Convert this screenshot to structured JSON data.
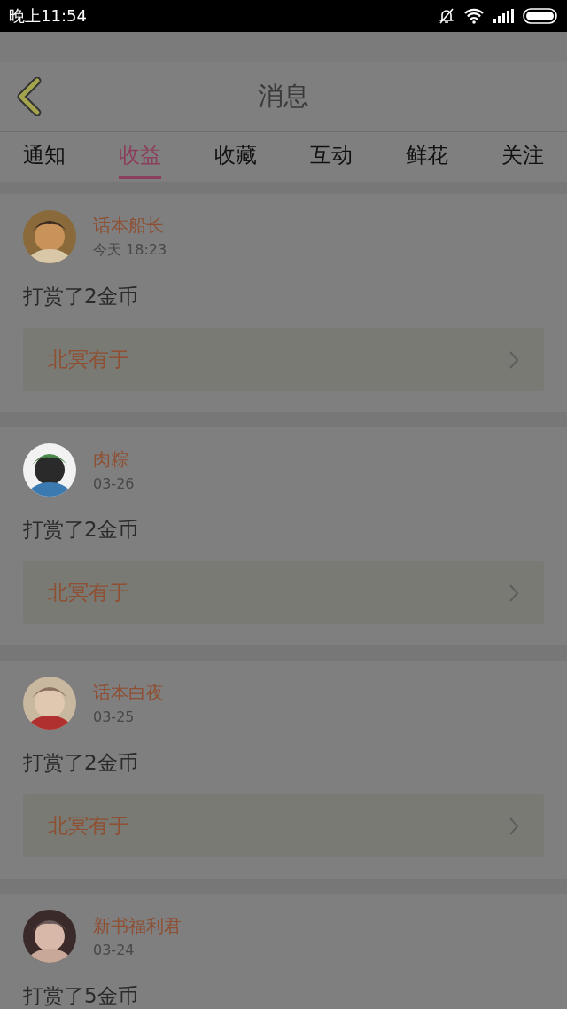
{
  "status_bar": {
    "time": "晚上11:54"
  },
  "header": {
    "title": "消息"
  },
  "tabs": [
    {
      "label": "通知",
      "selected": false
    },
    {
      "label": "收益",
      "selected": true
    },
    {
      "label": "收藏",
      "selected": false
    },
    {
      "label": "互动",
      "selected": false
    },
    {
      "label": "鲜花",
      "selected": false
    },
    {
      "label": "关注",
      "selected": false
    }
  ],
  "messages": [
    {
      "name": "话本船长",
      "time": "今天 18:23",
      "text": "打赏了2金币",
      "link": "北冥有于"
    },
    {
      "name": "肉粽",
      "time": "03-26",
      "text": "打赏了2金币",
      "link": "北冥有于"
    },
    {
      "name": "话本白夜",
      "time": "03-25",
      "text": "打赏了2金币",
      "link": "北冥有于"
    },
    {
      "name": "新书福利君",
      "time": "03-24",
      "text": "打赏了5金币"
    }
  ]
}
